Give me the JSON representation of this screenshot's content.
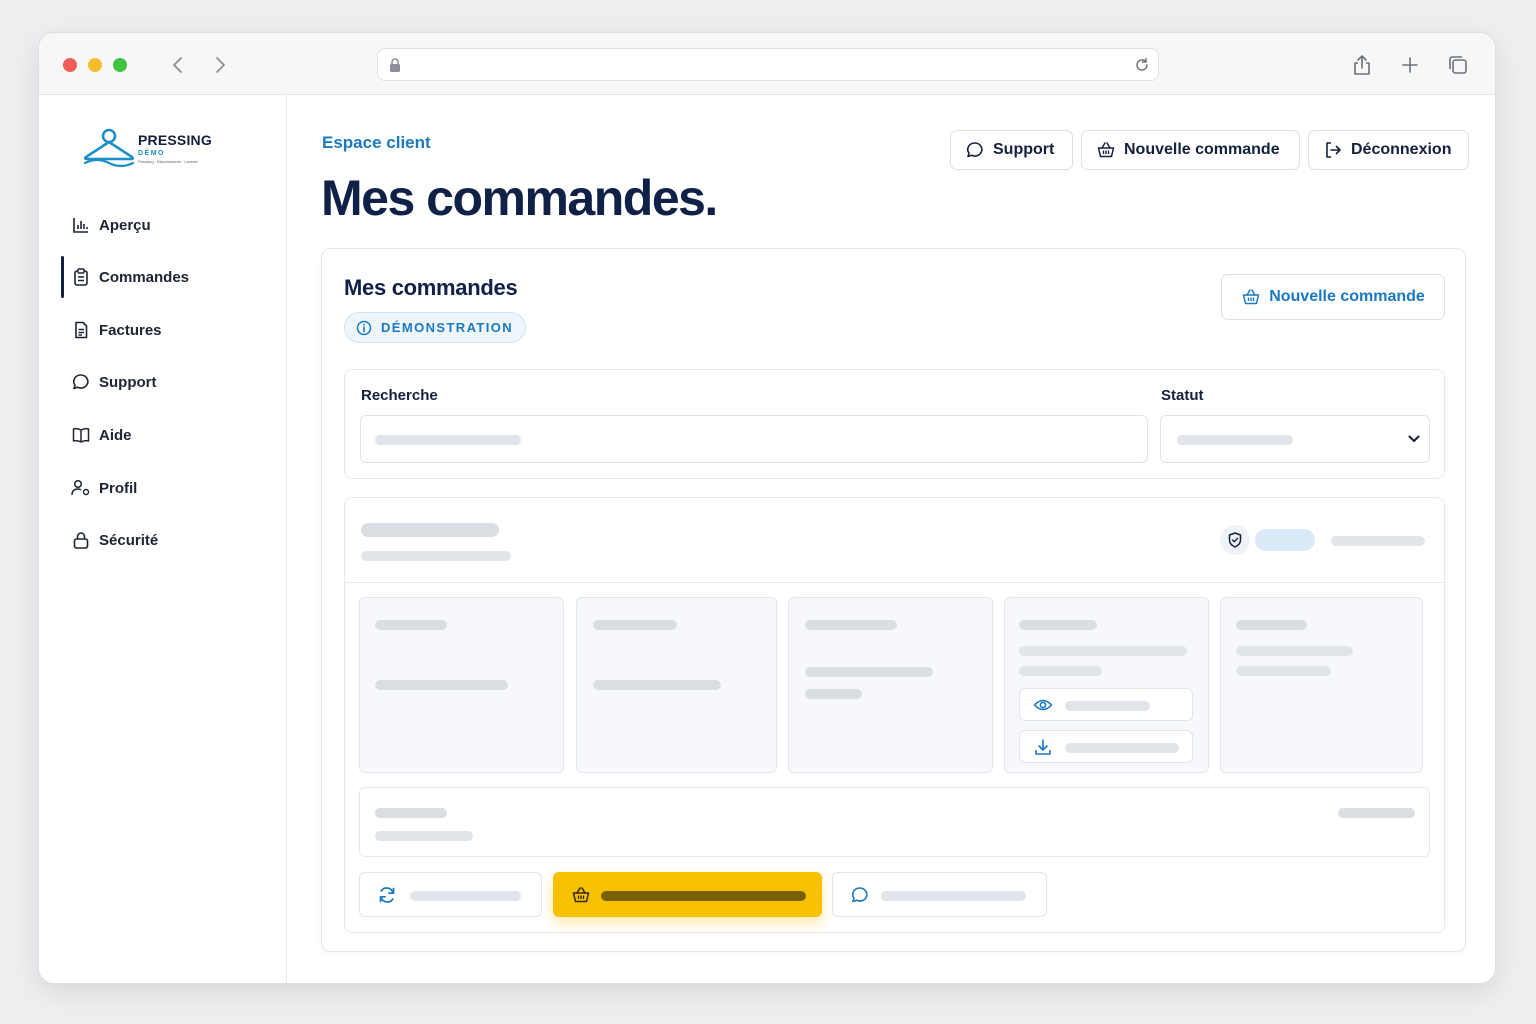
{
  "colors": {
    "accent": "#1b79c0",
    "title": "#0f2147",
    "primary_button": "#f6c100",
    "traffic_red": "#ee5f57",
    "traffic_yellow": "#f5bd2e",
    "traffic_green": "#3fc340"
  },
  "browser": {
    "icons": [
      "chevron-left-icon",
      "chevron-right-icon",
      "lock-icon",
      "reload-icon",
      "share-icon",
      "plus-icon",
      "tabs-icon"
    ]
  },
  "brand": {
    "name": "PRESSING",
    "demo": "DÉMO",
    "tagline": "Pressing · Blanchisserie · Laverie",
    "icon": "hanger-icon"
  },
  "sidebar": {
    "items": [
      {
        "label": "Aperçu",
        "icon": "chart-icon",
        "active": false
      },
      {
        "label": "Commandes",
        "icon": "clipboard-icon",
        "active": true
      },
      {
        "label": "Factures",
        "icon": "document-icon",
        "active": false
      },
      {
        "label": "Support",
        "icon": "chat-icon",
        "active": false
      },
      {
        "label": "Aide",
        "icon": "book-icon",
        "active": false
      },
      {
        "label": "Profil",
        "icon": "user-settings-icon",
        "active": false
      },
      {
        "label": "Sécurité",
        "icon": "lock-icon",
        "active": false
      }
    ]
  },
  "header": {
    "eyebrow": "Espace client",
    "title": "Mes commandes.",
    "buttons": {
      "support": "Support",
      "new_order": "Nouvelle commande",
      "logout": "Déconnexion"
    }
  },
  "card": {
    "title": "Mes commandes",
    "badge": "DÉMONSTRATION",
    "new_order_button": "Nouvelle commande",
    "filters": {
      "search_label": "Recherche",
      "status_label": "Statut"
    }
  }
}
